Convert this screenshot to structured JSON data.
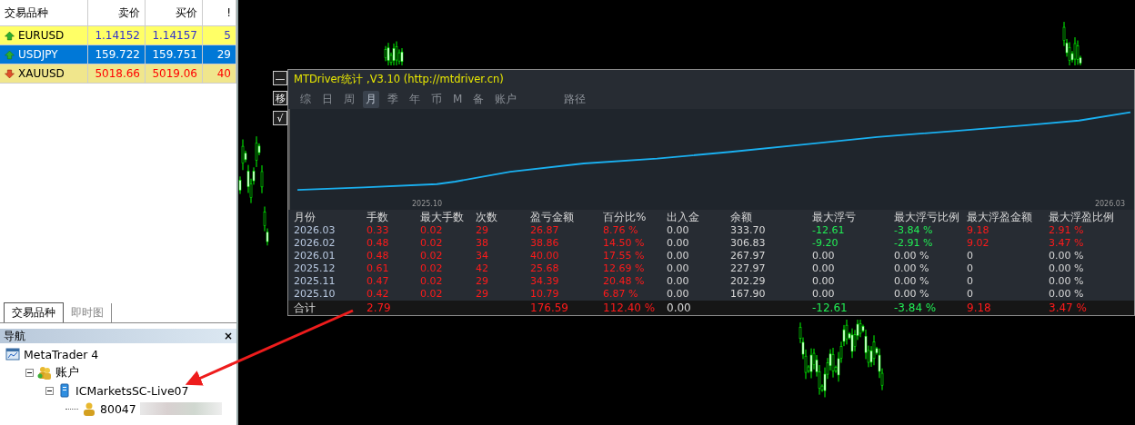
{
  "market_watch": {
    "columns": [
      "交易品种",
      "卖价",
      "买价",
      "!"
    ],
    "rows": [
      {
        "symbol": "EURUSD",
        "kind": "up",
        "selected": false,
        "color": "#ffff66",
        "prices": [
          {
            "text": "1.14152",
            "color": "#3333cc"
          },
          {
            "text": "1.14157",
            "color": "#3333cc"
          },
          {
            "text": "5",
            "color": "#3333cc"
          }
        ]
      },
      {
        "symbol": "USDJPY",
        "kind": "up",
        "selected": true,
        "color": "#0078d7",
        "prices": [
          {
            "text": "159.722",
            "color": "#ffffff"
          },
          {
            "text": "159.751",
            "color": "#ffffff"
          },
          {
            "text": "29",
            "color": "#ffffff"
          }
        ]
      },
      {
        "symbol": "XAUUSD",
        "kind": "down",
        "selected": false,
        "color": "#f0e68c",
        "prices": [
          {
            "text": "5018.66",
            "color": "#ff0000"
          },
          {
            "text": "5019.06",
            "color": "#ff0000"
          },
          {
            "text": "40",
            "color": "#ff0000"
          }
        ]
      }
    ]
  },
  "bottom_tabs": [
    {
      "label": "交易品种",
      "selected": true
    },
    {
      "label": "即时图",
      "selected": false
    }
  ],
  "navigator": {
    "title": "导航",
    "close": "×",
    "tree": [
      {
        "label": "MetaTrader 4",
        "kind": "app",
        "children": [
          {
            "label": "账户",
            "kind": "accounts",
            "children": [
              {
                "label": "ICMarketsSC-Live07",
                "kind": "server",
                "children": [
                  {
                    "label": "80047",
                    "kind": "user"
                  }
                ]
              }
            ]
          }
        ]
      }
    ]
  },
  "stats_panel": {
    "side_buttons": [
      "—",
      "移",
      "√"
    ],
    "title": "MTDriver统计 ,V3.10 (http://mtdriver.cn)",
    "tabs": [
      {
        "label": "综",
        "selected": false
      },
      {
        "label": "日",
        "selected": false
      },
      {
        "label": "周",
        "selected": false
      },
      {
        "label": "月",
        "selected": true
      },
      {
        "label": "季",
        "selected": false
      },
      {
        "label": "年",
        "selected": false
      },
      {
        "label": "币",
        "selected": false
      },
      {
        "label": "M",
        "selected": false
      },
      {
        "label": "备",
        "selected": false
      },
      {
        "label": "账户",
        "selected": false
      },
      {
        "label": "路径",
        "selected": false
      }
    ],
    "equity_chart": {
      "x_start": "2025.10",
      "x_end": "2026.03"
    },
    "columns": [
      "月份",
      "手数",
      "最大手数",
      "次数",
      "盈亏金额",
      "百分比%",
      "出入金",
      "余额",
      "最大浮亏",
      "最大浮亏比例",
      "最大浮盈金额",
      "最大浮盈比例"
    ],
    "rows": [
      [
        {
          "text": "2026.03",
          "color": "#b8c8e0"
        },
        {
          "text": "0.33",
          "color": "#ff1a1a"
        },
        {
          "text": "0.02",
          "color": "#ff1a1a"
        },
        {
          "text": "29",
          "color": "#ff1a1a"
        },
        {
          "text": "26.87",
          "color": "#ff1a1a"
        },
        {
          "text": "8.76 %",
          "color": "#ff1a1a"
        },
        {
          "text": "0.00",
          "color": "#d8d8d8"
        },
        {
          "text": "333.70",
          "color": "#d8d8d8"
        },
        {
          "text": "-12.61",
          "color": "#22ee55"
        },
        {
          "text": "-3.84 %",
          "color": "#22ee55"
        },
        {
          "text": "9.18",
          "color": "#ff1a1a"
        },
        {
          "text": "2.91 %",
          "color": "#ff1a1a"
        }
      ],
      [
        {
          "text": "2026.02",
          "color": "#b8c8e0"
        },
        {
          "text": "0.48",
          "color": "#ff1a1a"
        },
        {
          "text": "0.02",
          "color": "#ff1a1a"
        },
        {
          "text": "38",
          "color": "#ff1a1a"
        },
        {
          "text": "38.86",
          "color": "#ff1a1a"
        },
        {
          "text": "14.50 %",
          "color": "#ff1a1a"
        },
        {
          "text": "0.00",
          "color": "#d8d8d8"
        },
        {
          "text": "306.83",
          "color": "#d8d8d8"
        },
        {
          "text": "-9.20",
          "color": "#22ee55"
        },
        {
          "text": "-2.91 %",
          "color": "#22ee55"
        },
        {
          "text": "9.02",
          "color": "#ff1a1a"
        },
        {
          "text": "3.47 %",
          "color": "#ff1a1a"
        }
      ],
      [
        {
          "text": "2026.01",
          "color": "#b8c8e0"
        },
        {
          "text": "0.48",
          "color": "#ff1a1a"
        },
        {
          "text": "0.02",
          "color": "#ff1a1a"
        },
        {
          "text": "34",
          "color": "#ff1a1a"
        },
        {
          "text": "40.00",
          "color": "#ff1a1a"
        },
        {
          "text": "17.55 %",
          "color": "#ff1a1a"
        },
        {
          "text": "0.00",
          "color": "#d8d8d8"
        },
        {
          "text": "267.97",
          "color": "#d8d8d8"
        },
        {
          "text": "0.00",
          "color": "#d8d8d8"
        },
        {
          "text": "0.00 %",
          "color": "#d8d8d8"
        },
        {
          "text": "0",
          "color": "#d8d8d8"
        },
        {
          "text": "0.00 %",
          "color": "#d8d8d8"
        }
      ],
      [
        {
          "text": "2025.12",
          "color": "#b8c8e0"
        },
        {
          "text": "0.61",
          "color": "#ff1a1a"
        },
        {
          "text": "0.02",
          "color": "#ff1a1a"
        },
        {
          "text": "42",
          "color": "#ff1a1a"
        },
        {
          "text": "25.68",
          "color": "#ff1a1a"
        },
        {
          "text": "12.69 %",
          "color": "#ff1a1a"
        },
        {
          "text": "0.00",
          "color": "#d8d8d8"
        },
        {
          "text": "227.97",
          "color": "#d8d8d8"
        },
        {
          "text": "0.00",
          "color": "#d8d8d8"
        },
        {
          "text": "0.00 %",
          "color": "#d8d8d8"
        },
        {
          "text": "0",
          "color": "#d8d8d8"
        },
        {
          "text": "0.00 %",
          "color": "#d8d8d8"
        }
      ],
      [
        {
          "text": "2025.11",
          "color": "#b8c8e0"
        },
        {
          "text": "0.47",
          "color": "#ff1a1a"
        },
        {
          "text": "0.02",
          "color": "#ff1a1a"
        },
        {
          "text": "29",
          "color": "#ff1a1a"
        },
        {
          "text": "34.39",
          "color": "#ff1a1a"
        },
        {
          "text": "20.48 %",
          "color": "#ff1a1a"
        },
        {
          "text": "0.00",
          "color": "#d8d8d8"
        },
        {
          "text": "202.29",
          "color": "#d8d8d8"
        },
        {
          "text": "0.00",
          "color": "#d8d8d8"
        },
        {
          "text": "0.00 %",
          "color": "#d8d8d8"
        },
        {
          "text": "0",
          "color": "#d8d8d8"
        },
        {
          "text": "0.00 %",
          "color": "#d8d8d8"
        }
      ],
      [
        {
          "text": "2025.10",
          "color": "#b8c8e0"
        },
        {
          "text": "0.42",
          "color": "#ff1a1a"
        },
        {
          "text": "0.02",
          "color": "#ff1a1a"
        },
        {
          "text": "29",
          "color": "#ff1a1a"
        },
        {
          "text": "10.79",
          "color": "#ff1a1a"
        },
        {
          "text": "6.87 %",
          "color": "#ff1a1a"
        },
        {
          "text": "0.00",
          "color": "#d8d8d8"
        },
        {
          "text": "167.90",
          "color": "#d8d8d8"
        },
        {
          "text": "0.00",
          "color": "#d8d8d8"
        },
        {
          "text": "0.00 %",
          "color": "#d8d8d8"
        },
        {
          "text": "0",
          "color": "#d8d8d8"
        },
        {
          "text": "0.00 %",
          "color": "#d8d8d8"
        }
      ]
    ],
    "total": {
      "label": {
        "text": "合计"
      },
      "lots": {
        "text": "2.79",
        "color": "#ff1a1a"
      },
      "profit": {
        "text": "176.59",
        "color": "#ff1a1a"
      },
      "percent": {
        "text": "112.40 %",
        "color": "#ff1a1a"
      },
      "deposit": {
        "text": "0.00",
        "color": "#d8d8d8"
      },
      "max_loss": {
        "text": "-12.61",
        "color": "#22ee55"
      },
      "max_loss_pct": {
        "text": "-3.84 %",
        "color": "#22ee55"
      },
      "max_profit": {
        "text": "9.18",
        "color": "#ff1a1a"
      },
      "max_profit_pct": {
        "text": "3.47 %",
        "color": "#ff1a1a"
      }
    }
  }
}
